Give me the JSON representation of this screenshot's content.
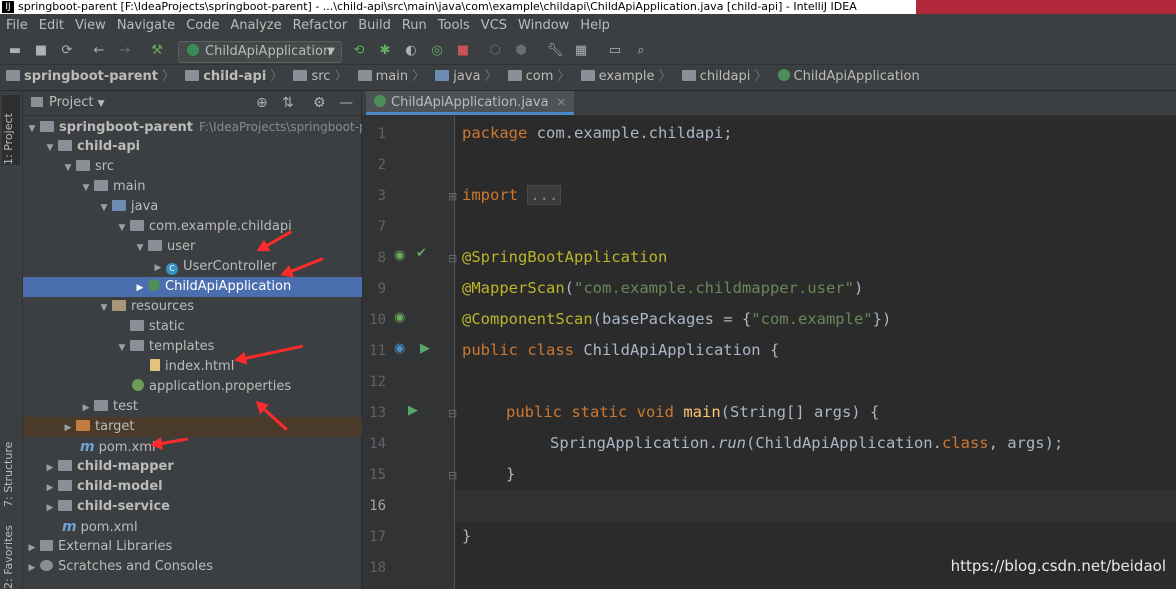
{
  "window": {
    "title": "springboot-parent [F:\\IdeaProjects\\springboot-parent] - ...\\child-api\\src\\main\\java\\com\\example\\childapi\\ChildApiApplication.java [child-api] - IntelliJ IDEA"
  },
  "menu": [
    "File",
    "Edit",
    "View",
    "Navigate",
    "Code",
    "Analyze",
    "Refactor",
    "Build",
    "Run",
    "Tools",
    "VCS",
    "Window",
    "Help"
  ],
  "toolbar": {
    "run_config": "ChildApiApplication"
  },
  "breadcrumbs": [
    "springboot-parent",
    "child-api",
    "src",
    "main",
    "java",
    "com",
    "example",
    "childapi",
    "ChildApiApplication"
  ],
  "sidebar_tabs": {
    "project": "1: Project",
    "structure": "7: Structure",
    "favorites": "2: Favorites"
  },
  "project_panel": {
    "title": "Project",
    "root_path": "F:\\IdeaProjects\\springboot-par",
    "tree": [
      "springboot-parent",
      "child-api",
      "src",
      "main",
      "java",
      "com.example.childapi",
      "user",
      "UserController",
      "ChildApiApplication",
      "resources",
      "static",
      "templates",
      "index.html",
      "application.properties",
      "test",
      "target",
      "pom.xml",
      "child-mapper",
      "child-model",
      "child-service",
      "pom.xml",
      "External Libraries",
      "Scratches and Consoles"
    ]
  },
  "editor": {
    "tab": "ChildApiApplication.java",
    "line_numbers": [
      "1",
      "2",
      "3",
      "7",
      "8",
      "9",
      "10",
      "11",
      "12",
      "13",
      "14",
      "15",
      "16",
      "17",
      "18"
    ],
    "code": {
      "l1_kw": "package",
      "l1_rest": " com.example.childapi;",
      "l3_kw": "import",
      "l3_fold": "...",
      "l8": "@SpringBootApplication",
      "l9_ann": "@MapperScan",
      "l9_open": "(",
      "l9_str": "\"com.example.childmapper.user\"",
      "l9_close": ")",
      "l10_ann": "@ComponentScan",
      "l10_mid": "(basePackages = {",
      "l10_str": "\"com.example\"",
      "l10_close": "})",
      "l11_kw": "public class",
      "l11_rest": " ChildApiApplication {",
      "l13_kw": "public static void",
      "l13_fn": "main",
      "l13_rest": "(String[] args) {",
      "l14_a": "SpringApplication.",
      "l14_run": "run",
      "l14_b": "(ChildApiApplication.",
      "l14_kw": "class",
      "l14_c": ", args);",
      "l15": "}",
      "l17": "}"
    }
  },
  "watermark": "https://blog.csdn.net/beidaol"
}
